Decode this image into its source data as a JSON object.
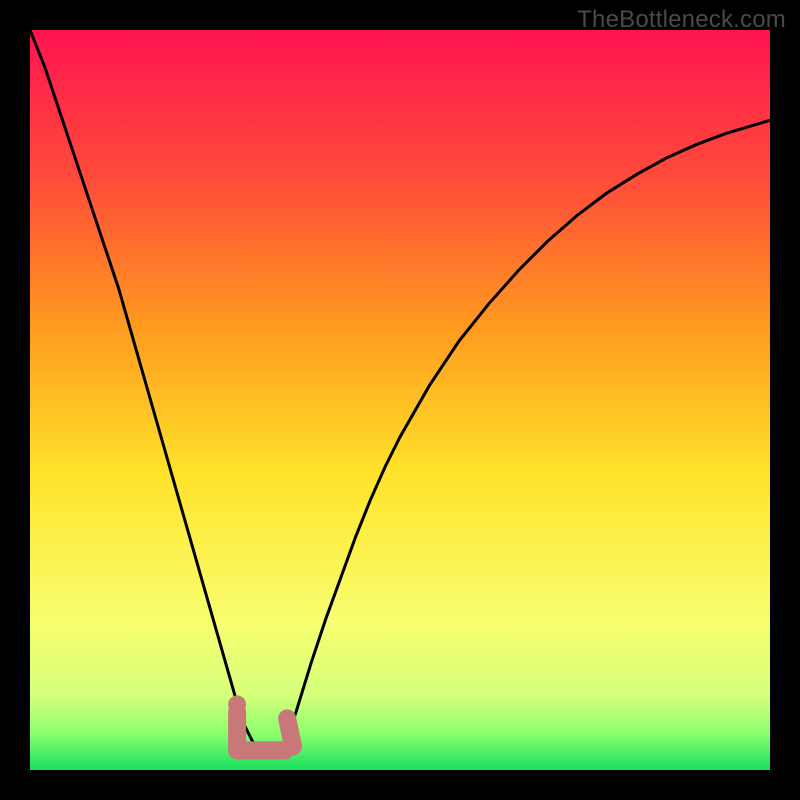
{
  "watermark": "TheBottleneck.com",
  "chart_data": {
    "type": "line",
    "title": "",
    "xlabel": "",
    "ylabel": "",
    "xlim": [
      0,
      100
    ],
    "ylim": [
      0,
      100
    ],
    "x": [
      0,
      2,
      4,
      6,
      8,
      10,
      12,
      14,
      16,
      18,
      20,
      22,
      24,
      26,
      28,
      29,
      30,
      31,
      32,
      33,
      34,
      35,
      36,
      38,
      40,
      42,
      44,
      46,
      48,
      50,
      54,
      58,
      62,
      66,
      70,
      74,
      78,
      82,
      86,
      90,
      94,
      98,
      100
    ],
    "values": [
      100,
      95,
      89,
      83,
      77,
      71,
      65,
      58,
      51,
      44,
      37,
      30,
      23,
      16,
      9,
      6,
      4,
      2.5,
      2,
      2,
      2.8,
      5,
      8,
      14.5,
      20.5,
      26,
      31.5,
      36.5,
      41,
      45,
      52,
      58,
      63,
      67.5,
      71.5,
      75,
      78,
      80.5,
      82.7,
      84.5,
      86,
      87.2,
      87.8
    ],
    "annotations": [
      {
        "shape": "u-marker",
        "x": 31.5,
        "y": 4,
        "color": "#c87878"
      }
    ],
    "gradient_stops": [
      {
        "offset": 0.0,
        "color": "#ff1450"
      },
      {
        "offset": 0.2,
        "color": "#ff4b3a"
      },
      {
        "offset": 0.4,
        "color": "#ff9a1f"
      },
      {
        "offset": 0.6,
        "color": "#ffe32a"
      },
      {
        "offset": 0.8,
        "color": "#f8ff70"
      },
      {
        "offset": 0.9,
        "color": "#d4ff7a"
      },
      {
        "offset": 0.95,
        "color": "#8dff6e"
      },
      {
        "offset": 1.0,
        "color": "#18e060"
      }
    ]
  }
}
